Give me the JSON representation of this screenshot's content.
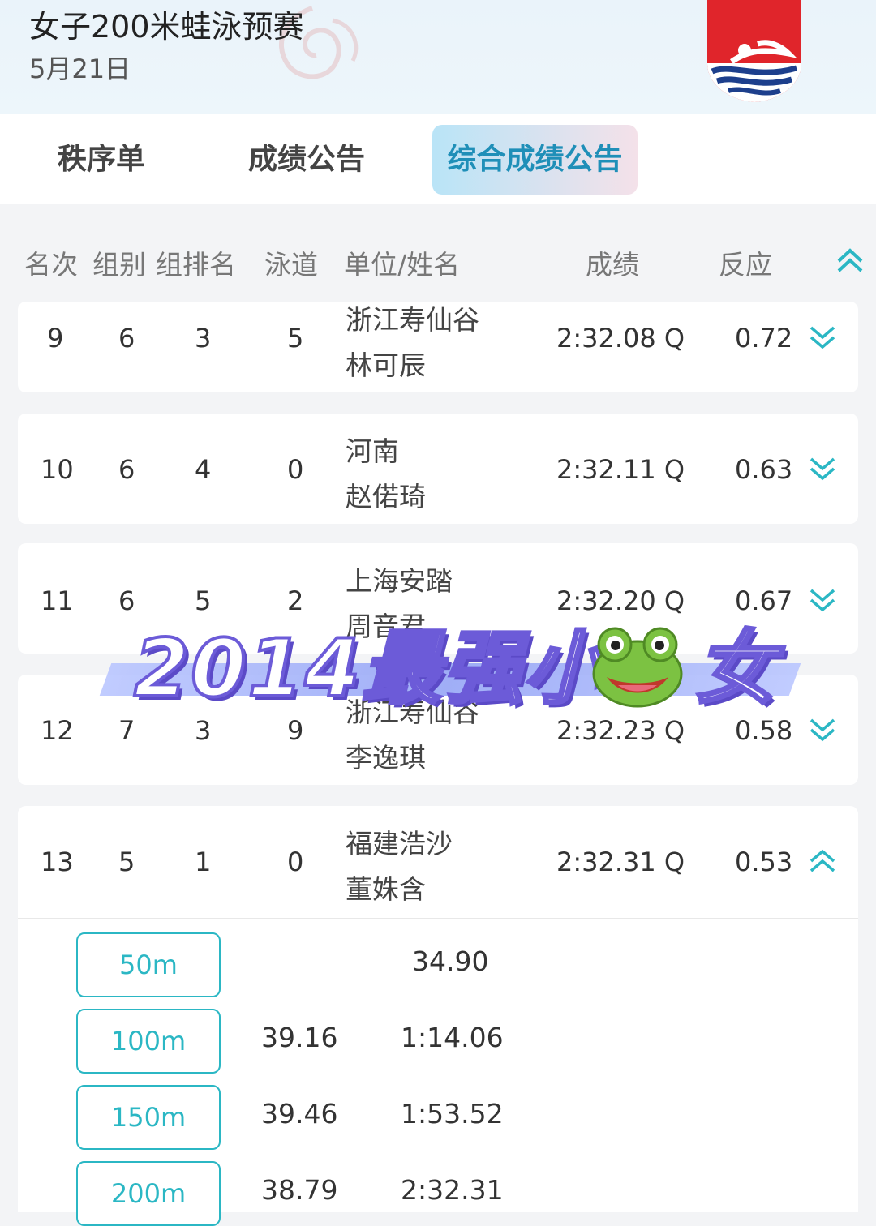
{
  "header": {
    "title": "女子200米蛙泳预赛",
    "date": "5月21日"
  },
  "tabs": [
    {
      "label": "秩序单",
      "active": false
    },
    {
      "label": "成绩公告",
      "active": false
    },
    {
      "label": "综合成绩公告",
      "active": true
    }
  ],
  "columns": [
    "名次",
    "组别",
    "组排名",
    "泳道",
    "单位/姓名",
    "成绩",
    "反应"
  ],
  "rows": [
    {
      "rank": "9",
      "heat": "6",
      "heat_rank": "3",
      "lane": "5",
      "org": "浙江寿仙谷",
      "name": "林可辰",
      "result": "2:32.08 Q",
      "reaction": "0.72",
      "expanded": false
    },
    {
      "rank": "10",
      "heat": "6",
      "heat_rank": "4",
      "lane": "0",
      "org": "河南",
      "name": "赵偌琦",
      "result": "2:32.11 Q",
      "reaction": "0.63",
      "expanded": false
    },
    {
      "rank": "11",
      "heat": "6",
      "heat_rank": "5",
      "lane": "2",
      "org": "上海安踏",
      "name": "周音君",
      "result": "2:32.20 Q",
      "reaction": "0.67",
      "expanded": false
    },
    {
      "rank": "12",
      "heat": "7",
      "heat_rank": "3",
      "lane": "9",
      "org": "浙江寿仙谷",
      "name": "李逸琪",
      "result": "2:32.23 Q",
      "reaction": "0.58",
      "expanded": false
    },
    {
      "rank": "13",
      "heat": "5",
      "heat_rank": "1",
      "lane": "0",
      "org": "福建浩沙",
      "name": "董姝含",
      "result": "2:32.31 Q",
      "reaction": "0.53",
      "expanded": true
    }
  ],
  "splits": [
    {
      "distance": "50m",
      "split": "",
      "cumulative": "34.90"
    },
    {
      "distance": "100m",
      "split": "39.16",
      "cumulative": "1:14.06"
    },
    {
      "distance": "150m",
      "split": "39.46",
      "cumulative": "1:53.52"
    },
    {
      "distance": "200m",
      "split": "38.79",
      "cumulative": "2:32.31"
    }
  ],
  "overlay": {
    "text": "2014最强小",
    "emoji": "frog-face",
    "suffix": "女"
  },
  "colors": {
    "accent": "#2bb7c4",
    "tab_active_text": "#1f8fb8",
    "logo_red": "#e0252b",
    "logo_blue": "#1d3f8c",
    "banner_purple": "#6c5bd8"
  }
}
